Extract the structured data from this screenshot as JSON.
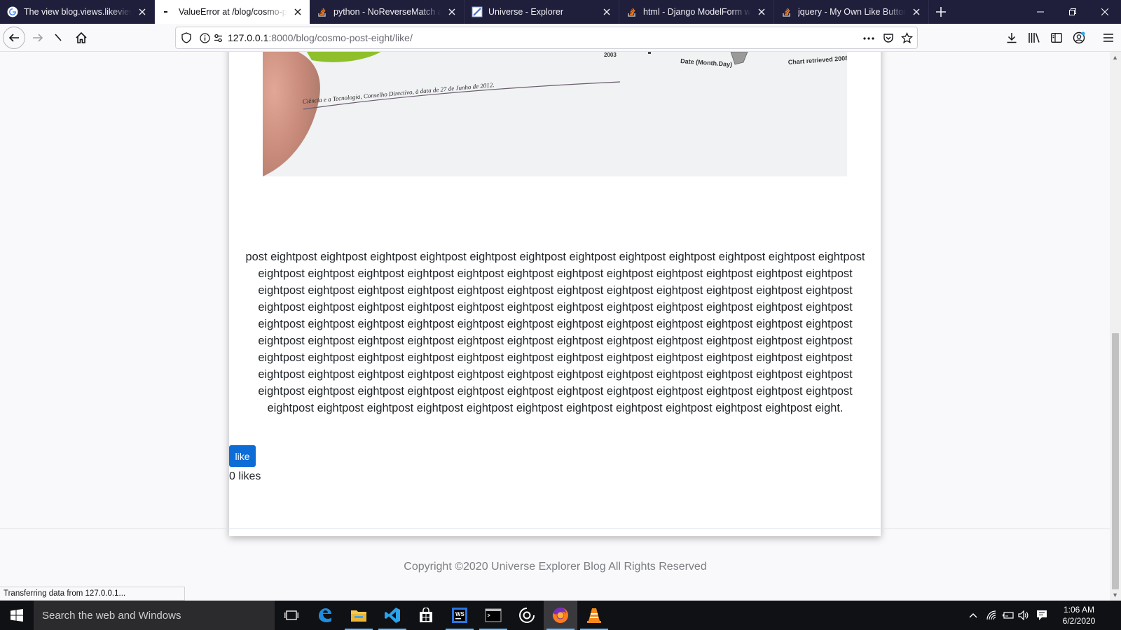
{
  "browser": {
    "tabs": [
      {
        "label": "The view blog.views.likeview didn't return an HttpResponse object",
        "icon": "google-icon"
      },
      {
        "label": "ValueError at /blog/cosmo-post-eight/like/",
        "icon": "loading-icon",
        "active": true
      },
      {
        "label": "python - NoReverseMatch at /blog/",
        "icon": "stackoverflow-icon"
      },
      {
        "label": "Universe - Explorer",
        "icon": "page-icon"
      },
      {
        "label": "html - Django ModelForm with",
        "icon": "stackoverflow-icon"
      },
      {
        "label": "jquery - My Own Like Button: Django",
        "icon": "stackoverflow-icon"
      }
    ],
    "url_host": "127.0.0.1",
    "url_rest": ":8000/blog/cosmo-post-eight/like/",
    "status_text": "Transferring data from 127.0.0.1..."
  },
  "page": {
    "image_caption": "Ciência e a Tecnologia, Conselho Directivo, à data de 27 de Junho de 2012.",
    "image_label_date": "Date (Month.Day)",
    "image_label_chart": "Chart retrieved 2008",
    "image_label_year": "2003",
    "post_text": "post eightpost eightpost eightpost eightpost eightpost eightpost eightpost eightpost eightpost eightpost eightpost eightpost eightpost eightpost eightpost eightpost eightpost eightpost eightpost eightpost eightpost eightpost eightpost eightpost eightpost eightpost eightpost eightpost eightpost eightpost eightpost eightpost eightpost eightpost eightpost eightpost eightpost eightpost eightpost eightpost eightpost eightpost eightpost eightpost eightpost eightpost eightpost eightpost eightpost eightpost eightpost eightpost eightpost eightpost eightpost eightpost eightpost eightpost eightpost eightpost eightpost eightpost eightpost eightpost eightpost eightpost eightpost eightpost eightpost eightpost eightpost eightpost eightpost eightpost eightpost eightpost eightpost eightpost eightpost eightpost eightpost eightpost eightpost eightpost eightpost eightpost eightpost eightpost eightpost eightpost eightpost eightpost eightpost eightpost eightpost eightpost eightpost eightpost eightpost eightpost eightpost eightpost eightpost eightpost eightpost eightpost eightpost eightpost eightpost eightpost eightpost eightpost eightpost eightpost eightpost eightpost eightpost eightpost eightpost eight.",
    "like_label": "like",
    "like_count": "0 likes",
    "copyright": "Copyright ©2020 Universe Explorer Blog All Rights Reserved"
  },
  "taskbar": {
    "search_placeholder": "Search the web and Windows",
    "time": "1:06 AM",
    "date": "6/2/2020"
  },
  "colors": {
    "like_button": "#0d6cd6",
    "tabbar_bg": "#1f1e3b",
    "taskbar_bg": "#101114"
  }
}
